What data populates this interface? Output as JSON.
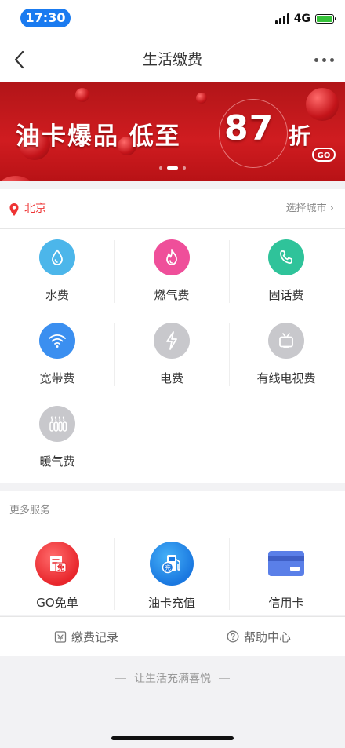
{
  "status_bar": {
    "time": "17:30",
    "network": "4G"
  },
  "nav": {
    "title": "生活缴费"
  },
  "banner": {
    "headline": "油卡爆品 低至",
    "number": "87",
    "suffix": "折",
    "badge": "GO"
  },
  "city": {
    "current": "北京",
    "choose_label": "选择城市"
  },
  "utilities": [
    {
      "label": "水费",
      "icon": "water-drop-icon",
      "color": "#4cb6ea"
    },
    {
      "label": "燃气费",
      "icon": "flame-icon",
      "color": "#ef4f9a"
    },
    {
      "label": "固话费",
      "icon": "phone-icon",
      "color": "#2fc39a"
    },
    {
      "label": "宽带费",
      "icon": "wifi-icon",
      "color": "#3b8ff0"
    },
    {
      "label": "电费",
      "icon": "lightning-icon",
      "color": "#c8c8cc"
    },
    {
      "label": "有线电视费",
      "icon": "tv-icon",
      "color": "#c8c8cc"
    },
    {
      "label": "暖气费",
      "icon": "radiator-icon",
      "color": "#c8c8cc"
    }
  ],
  "more_services": {
    "title": "更多服务",
    "items": [
      {
        "label": "GO免单",
        "icon": "free-order-icon"
      },
      {
        "label": "油卡充值",
        "icon": "fuel-card-icon"
      },
      {
        "label": "信用卡",
        "icon": "credit-card-icon"
      }
    ]
  },
  "bottom_links": {
    "records": "缴费记录",
    "help": "帮助中心"
  },
  "footer": {
    "slogan": "让生活充满喜悦"
  },
  "colors": {
    "accent_red": "#e33333",
    "brand_blue": "#1a7bf0"
  }
}
